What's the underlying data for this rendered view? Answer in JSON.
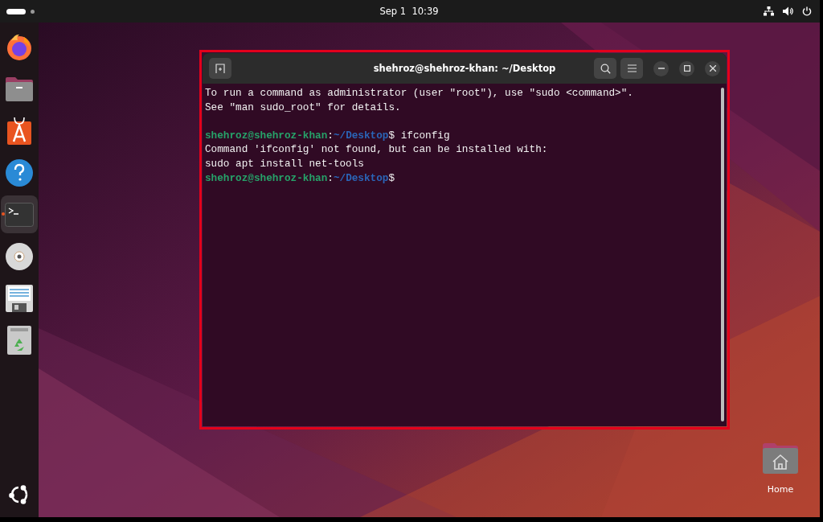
{
  "top_bar": {
    "clock": "Sep 1  10:39"
  },
  "dock": {
    "items": [
      {
        "kind": "browser",
        "selected": false
      },
      {
        "kind": "files",
        "selected": false
      },
      {
        "kind": "store",
        "selected": false
      },
      {
        "kind": "help",
        "selected": false
      },
      {
        "kind": "terminal",
        "selected": true
      },
      {
        "kind": "disc",
        "selected": false
      },
      {
        "kind": "document",
        "selected": false
      },
      {
        "kind": "trash",
        "selected": false
      }
    ]
  },
  "terminal": {
    "title": "shehroz@shehroz-khan: ~/Desktop",
    "lines": [
      {
        "kind": "output",
        "text": "To run a command as administrator (user \"root\"), use \"sudo <command>\"."
      },
      {
        "kind": "output",
        "text": "See \"man sudo_root\" for details."
      },
      {
        "kind": "blank"
      },
      {
        "kind": "prompt",
        "user": "shehroz@shehroz-khan",
        "separator": ":",
        "path": "~/Desktop",
        "symbol": "$",
        "command": "ifconfig"
      },
      {
        "kind": "output",
        "text": "Command 'ifconfig' not found, but can be installed with:"
      },
      {
        "kind": "output",
        "text": "sudo apt install net-tools"
      },
      {
        "kind": "prompt",
        "user": "shehroz@shehroz-khan",
        "separator": ":",
        "path": "~/Desktop",
        "symbol": "$"
      }
    ]
  },
  "desktop_icons": [
    {
      "label": "Home"
    }
  ]
}
